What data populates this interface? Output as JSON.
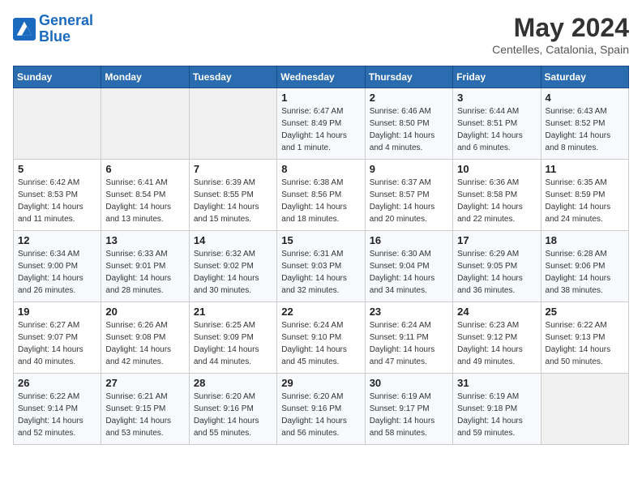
{
  "header": {
    "logo_line1": "General",
    "logo_line2": "Blue",
    "month": "May 2024",
    "location": "Centelles, Catalonia, Spain"
  },
  "days_of_week": [
    "Sunday",
    "Monday",
    "Tuesday",
    "Wednesday",
    "Thursday",
    "Friday",
    "Saturday"
  ],
  "weeks": [
    [
      {
        "day": "",
        "info": ""
      },
      {
        "day": "",
        "info": ""
      },
      {
        "day": "",
        "info": ""
      },
      {
        "day": "1",
        "info": "Sunrise: 6:47 AM\nSunset: 8:49 PM\nDaylight: 14 hours\nand 1 minute."
      },
      {
        "day": "2",
        "info": "Sunrise: 6:46 AM\nSunset: 8:50 PM\nDaylight: 14 hours\nand 4 minutes."
      },
      {
        "day": "3",
        "info": "Sunrise: 6:44 AM\nSunset: 8:51 PM\nDaylight: 14 hours\nand 6 minutes."
      },
      {
        "day": "4",
        "info": "Sunrise: 6:43 AM\nSunset: 8:52 PM\nDaylight: 14 hours\nand 8 minutes."
      }
    ],
    [
      {
        "day": "5",
        "info": "Sunrise: 6:42 AM\nSunset: 8:53 PM\nDaylight: 14 hours\nand 11 minutes."
      },
      {
        "day": "6",
        "info": "Sunrise: 6:41 AM\nSunset: 8:54 PM\nDaylight: 14 hours\nand 13 minutes."
      },
      {
        "day": "7",
        "info": "Sunrise: 6:39 AM\nSunset: 8:55 PM\nDaylight: 14 hours\nand 15 minutes."
      },
      {
        "day": "8",
        "info": "Sunrise: 6:38 AM\nSunset: 8:56 PM\nDaylight: 14 hours\nand 18 minutes."
      },
      {
        "day": "9",
        "info": "Sunrise: 6:37 AM\nSunset: 8:57 PM\nDaylight: 14 hours\nand 20 minutes."
      },
      {
        "day": "10",
        "info": "Sunrise: 6:36 AM\nSunset: 8:58 PM\nDaylight: 14 hours\nand 22 minutes."
      },
      {
        "day": "11",
        "info": "Sunrise: 6:35 AM\nSunset: 8:59 PM\nDaylight: 14 hours\nand 24 minutes."
      }
    ],
    [
      {
        "day": "12",
        "info": "Sunrise: 6:34 AM\nSunset: 9:00 PM\nDaylight: 14 hours\nand 26 minutes."
      },
      {
        "day": "13",
        "info": "Sunrise: 6:33 AM\nSunset: 9:01 PM\nDaylight: 14 hours\nand 28 minutes."
      },
      {
        "day": "14",
        "info": "Sunrise: 6:32 AM\nSunset: 9:02 PM\nDaylight: 14 hours\nand 30 minutes."
      },
      {
        "day": "15",
        "info": "Sunrise: 6:31 AM\nSunset: 9:03 PM\nDaylight: 14 hours\nand 32 minutes."
      },
      {
        "day": "16",
        "info": "Sunrise: 6:30 AM\nSunset: 9:04 PM\nDaylight: 14 hours\nand 34 minutes."
      },
      {
        "day": "17",
        "info": "Sunrise: 6:29 AM\nSunset: 9:05 PM\nDaylight: 14 hours\nand 36 minutes."
      },
      {
        "day": "18",
        "info": "Sunrise: 6:28 AM\nSunset: 9:06 PM\nDaylight: 14 hours\nand 38 minutes."
      }
    ],
    [
      {
        "day": "19",
        "info": "Sunrise: 6:27 AM\nSunset: 9:07 PM\nDaylight: 14 hours\nand 40 minutes."
      },
      {
        "day": "20",
        "info": "Sunrise: 6:26 AM\nSunset: 9:08 PM\nDaylight: 14 hours\nand 42 minutes."
      },
      {
        "day": "21",
        "info": "Sunrise: 6:25 AM\nSunset: 9:09 PM\nDaylight: 14 hours\nand 44 minutes."
      },
      {
        "day": "22",
        "info": "Sunrise: 6:24 AM\nSunset: 9:10 PM\nDaylight: 14 hours\nand 45 minutes."
      },
      {
        "day": "23",
        "info": "Sunrise: 6:24 AM\nSunset: 9:11 PM\nDaylight: 14 hours\nand 47 minutes."
      },
      {
        "day": "24",
        "info": "Sunrise: 6:23 AM\nSunset: 9:12 PM\nDaylight: 14 hours\nand 49 minutes."
      },
      {
        "day": "25",
        "info": "Sunrise: 6:22 AM\nSunset: 9:13 PM\nDaylight: 14 hours\nand 50 minutes."
      }
    ],
    [
      {
        "day": "26",
        "info": "Sunrise: 6:22 AM\nSunset: 9:14 PM\nDaylight: 14 hours\nand 52 minutes."
      },
      {
        "day": "27",
        "info": "Sunrise: 6:21 AM\nSunset: 9:15 PM\nDaylight: 14 hours\nand 53 minutes."
      },
      {
        "day": "28",
        "info": "Sunrise: 6:20 AM\nSunset: 9:16 PM\nDaylight: 14 hours\nand 55 minutes."
      },
      {
        "day": "29",
        "info": "Sunrise: 6:20 AM\nSunset: 9:16 PM\nDaylight: 14 hours\nand 56 minutes."
      },
      {
        "day": "30",
        "info": "Sunrise: 6:19 AM\nSunset: 9:17 PM\nDaylight: 14 hours\nand 58 minutes."
      },
      {
        "day": "31",
        "info": "Sunrise: 6:19 AM\nSunset: 9:18 PM\nDaylight: 14 hours\nand 59 minutes."
      },
      {
        "day": "",
        "info": ""
      }
    ]
  ]
}
